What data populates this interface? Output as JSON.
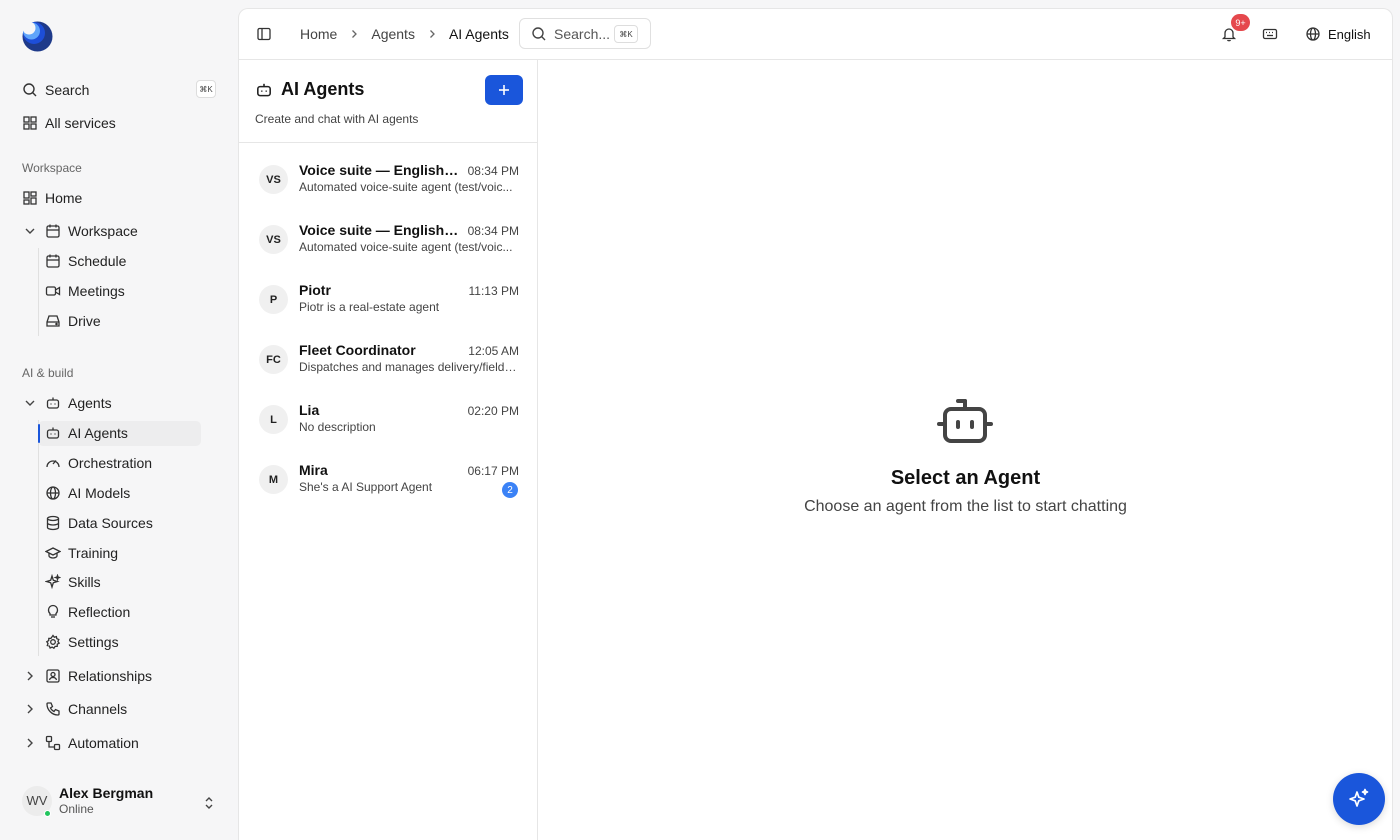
{
  "sidebar": {
    "search_label": "Search",
    "search_shortcut": "⌘K",
    "all_services": "All services",
    "section_workspace": "Workspace",
    "home": "Home",
    "workspace_group": "Workspace",
    "workspace_items": [
      "Schedule",
      "Meetings",
      "Drive"
    ],
    "section_ai": "AI & build",
    "agents_group": "Agents",
    "agents_items": [
      "AI Agents",
      "Orchestration",
      "AI Models",
      "Data Sources",
      "Training",
      "Skills",
      "Reflection",
      "Settings"
    ],
    "relationships": "Relationships",
    "channels": "Channels",
    "automation": "Automation"
  },
  "user": {
    "initials": "WV",
    "name": "Alex Bergman",
    "status": "Online"
  },
  "topbar": {
    "breadcrumbs": [
      "Home",
      "Agents",
      "AI Agents"
    ],
    "search_placeholder": "Search...",
    "search_shortcut": "⌘K",
    "notification_count": "9+",
    "language": "English"
  },
  "agents_panel": {
    "title": "AI Agents",
    "subtitle": "Create and chat with AI agents",
    "agents": [
      {
        "initials": "VS",
        "name": "Voice suite — English +...",
        "time": "08:34 PM",
        "desc": "Automated voice-suite agent (test/voic...",
        "badge": ""
      },
      {
        "initials": "VS",
        "name": "Voice suite — English o...",
        "time": "08:34 PM",
        "desc": "Automated voice-suite agent (test/voic...",
        "badge": ""
      },
      {
        "initials": "P",
        "name": "Piotr",
        "time": "11:13 PM",
        "desc": "Piotr is a real-estate agent",
        "badge": ""
      },
      {
        "initials": "FC",
        "name": "Fleet Coordinator",
        "time": "12:05 AM",
        "desc": "Dispatches and manages delivery/field ...",
        "badge": ""
      },
      {
        "initials": "L",
        "name": "Lia",
        "time": "02:20 PM",
        "desc": "No description",
        "badge": ""
      },
      {
        "initials": "M",
        "name": "Mira",
        "time": "06:17 PM",
        "desc": "She's a AI Support Agent",
        "badge": "2"
      }
    ]
  },
  "empty_state": {
    "title": "Select an Agent",
    "subtitle": "Choose an agent from the list to start chatting"
  },
  "colors": {
    "accent": "#1a56db",
    "badge_red": "#e5484d",
    "online_green": "#22c55e"
  }
}
